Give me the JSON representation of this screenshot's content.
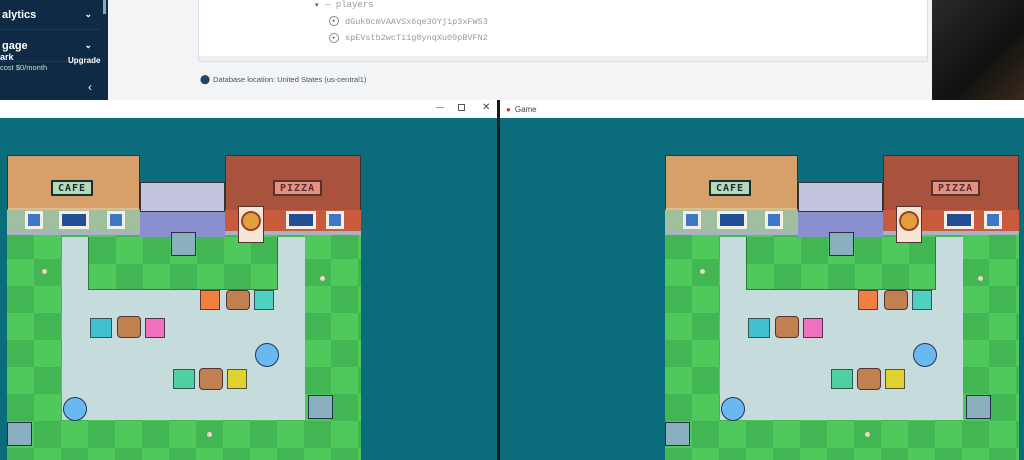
{
  "sidebar": {
    "items": [
      {
        "label": "alytics"
      },
      {
        "label": "gage"
      }
    ],
    "plan": {
      "name": "ark",
      "cost": "cost $0/month",
      "upgrade_label": "Upgrade"
    },
    "collapse_icon": "chevron-left-icon"
  },
  "database": {
    "node": "players",
    "children": [
      "dGuk9cmVAAVSx6qe3OYj1p3xFW53",
      "spEVstb2wcTi1g8ynqXu09pBVFN2"
    ],
    "location": "Database location: United States (us-central1)"
  },
  "windows": [
    {
      "title": "",
      "controls": [
        "minimize",
        "maximize",
        "close"
      ]
    },
    {
      "title": "Game"
    }
  ],
  "game": {
    "cafe_sign": "CAFE",
    "pizza_sign": "PIZZA"
  },
  "colors": {
    "teal": "#0b6d7c",
    "navy": "#0f2a44"
  }
}
